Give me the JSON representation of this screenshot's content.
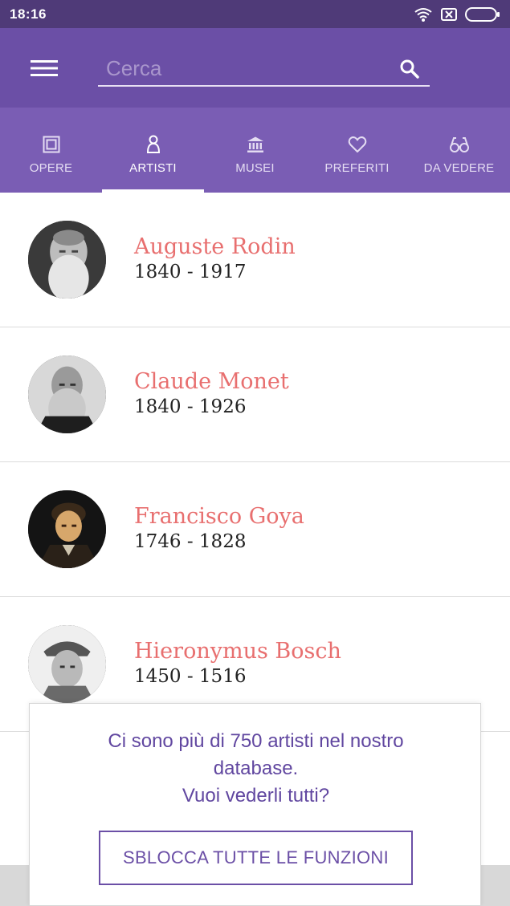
{
  "status_bar": {
    "time": "18:16",
    "icons": [
      "wifi-icon",
      "sim-icon",
      "battery-icon"
    ]
  },
  "app_bar": {
    "menu_icon": "hamburger-menu-icon",
    "search": {
      "placeholder": "Cerca",
      "value": "",
      "icon": "search-icon"
    }
  },
  "tabs": [
    {
      "label": "OPERE",
      "icon": "frame-icon",
      "active": false
    },
    {
      "label": "ARTISTI",
      "icon": "person-icon",
      "active": true
    },
    {
      "label": "MUSEI",
      "icon": "museum-icon",
      "active": false
    },
    {
      "label": "PREFERITI",
      "icon": "heart-icon",
      "active": false
    },
    {
      "label": "DA VEDERE",
      "icon": "glasses-icon",
      "active": false
    }
  ],
  "artists": [
    {
      "name": "Auguste Rodin",
      "dates": "1840 - 1917"
    },
    {
      "name": "Claude Monet",
      "dates": "1840 - 1926"
    },
    {
      "name": "Francisco Goya",
      "dates": "1746 - 1828"
    },
    {
      "name": "Hieronymus Bosch",
      "dates": "1450 - 1516"
    }
  ],
  "upsell": {
    "line1": "Ci sono più di 750 artisti nel nostro",
    "line2": "database.",
    "line3": "Vuoi vederli tutti?",
    "button_label": "SBLOCCA TUTTE LE FUNZIONI"
  },
  "colors": {
    "status_bar": "#4f3a78",
    "app_bar": "#6b4fa6",
    "tab_bar": "#7a5db4",
    "artist_name": "#e86f6f",
    "upsell_text": "#6147a0"
  }
}
